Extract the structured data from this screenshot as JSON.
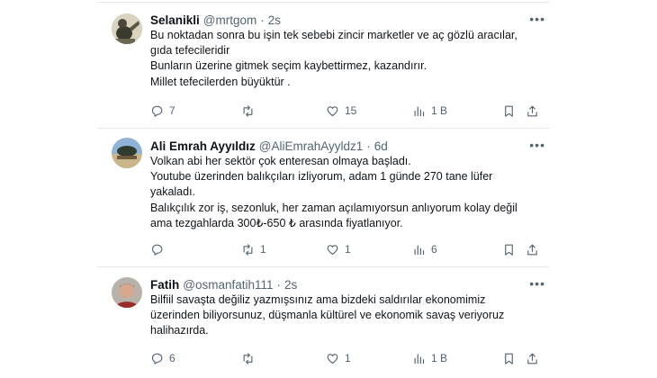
{
  "tweets": [
    {
      "name": "Selanikli",
      "handle": "@mrtgom",
      "dot": "·",
      "time": "2s",
      "lines": [
        "Bu noktadan sonra bu işin tek sebebi zincir marketler ve aç gözlü aracılar,",
        "gıda tefecileridir",
        "Bunların üzerine gitmek seçim kaybettirmez, kazandırır.",
        "Millet tefecilerden büyüktür ."
      ],
      "reply_count": "7",
      "retweet_count": "",
      "like_count": "15",
      "view_count": "1 B"
    },
    {
      "name": "Ali Emrah Ayyıldız",
      "handle": "@AliEmrahAyyldz1",
      "dot": "·",
      "time": "6d",
      "lines": [
        "Volkan abi her sektör çok enteresan olmaya başladı.",
        "Youtube üzerinden balıkçıları izliyorum, adam 1 günde 270 tane lüfer",
        "yakaladı.",
        "Balıkçılık zor iş, sezonluk, her zaman açılamıyorsun anlıyorum kolay değil",
        "ama tezgahlarda 300₺-650 ₺ arasında fiyatlanıyor."
      ],
      "reply_count": "",
      "retweet_count": "1",
      "like_count": "1",
      "view_count": "6"
    },
    {
      "name": "Fatih",
      "handle": "@osmanfatih111",
      "dot": "·",
      "time": "2s",
      "lines": [
        "Bilfiil savaşta değiliz yazmışsınız ama bizdeki saldırılar ekonomimiz",
        "üzerinden biliyorsunuz, düşmanla kültürel ve ekonomik savaş veriyoruz",
        "halihazırda."
      ],
      "reply_count": "6",
      "retweet_count": "",
      "like_count": "1",
      "view_count": "1 B"
    }
  ],
  "icons": [
    "reply-icon",
    "retweet-icon",
    "like-icon",
    "views-icon",
    "bookmark-icon",
    "share-icon",
    "more-icon"
  ],
  "colors": {
    "text": "#0f1419",
    "secondary": "#536471",
    "divider": "#e6e9ec"
  }
}
